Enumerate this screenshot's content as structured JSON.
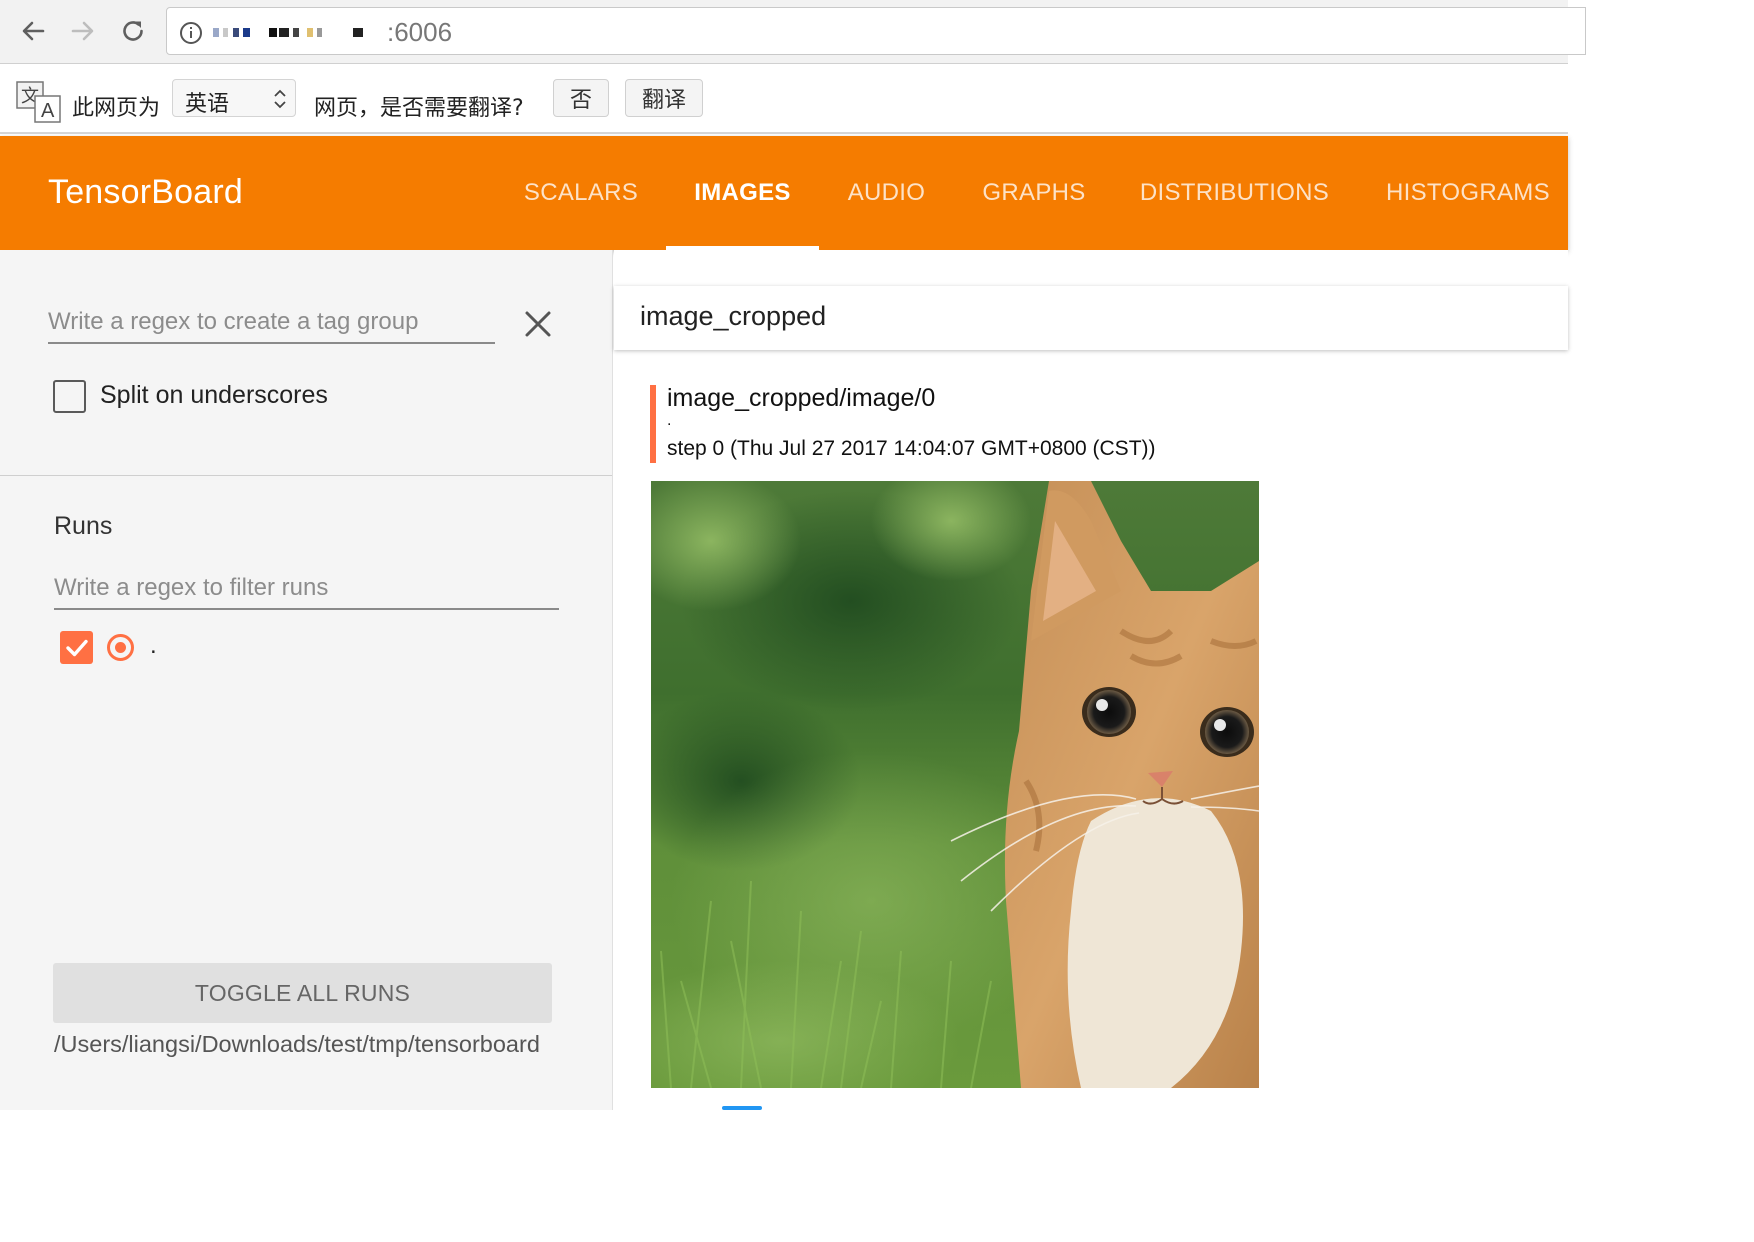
{
  "browser": {
    "url_port": ":6006"
  },
  "translate_bar": {
    "prefix": "此网页为",
    "language": "英语",
    "question": "网页，是否需要翻译?",
    "no_button": "否",
    "translate_button": "翻译"
  },
  "header": {
    "brand": "TensorBoard",
    "tabs": [
      {
        "label": "SCALARS"
      },
      {
        "label": "IMAGES"
      },
      {
        "label": "AUDIO"
      },
      {
        "label": "GRAPHS"
      },
      {
        "label": "DISTRIBUTIONS"
      },
      {
        "label": "HISTOGRAMS"
      }
    ],
    "active_tab": "IMAGES",
    "color": "#f57c00"
  },
  "sidebar": {
    "tag_regex_placeholder": "Write a regex to create a tag group",
    "split_label": "Split on underscores",
    "split_checked": false,
    "runs_title": "Runs",
    "runs_filter_placeholder": "Write a regex to filter runs",
    "runs": [
      {
        "name": ".",
        "checked": true,
        "color": "#ff7043"
      }
    ],
    "toggle_label": "TOGGLE ALL RUNS",
    "logdir": "/Users/liangsi/Downloads/test/tmp/tensorboard"
  },
  "main": {
    "group_title": "image_cropped",
    "card": {
      "tag": "image_cropped/image/0",
      "run": ".",
      "step_text": "step 0 (Thu Jul 27 2017 14:04:07 GMT+0800 (CST))",
      "image_subject": "kitten-photo"
    }
  }
}
